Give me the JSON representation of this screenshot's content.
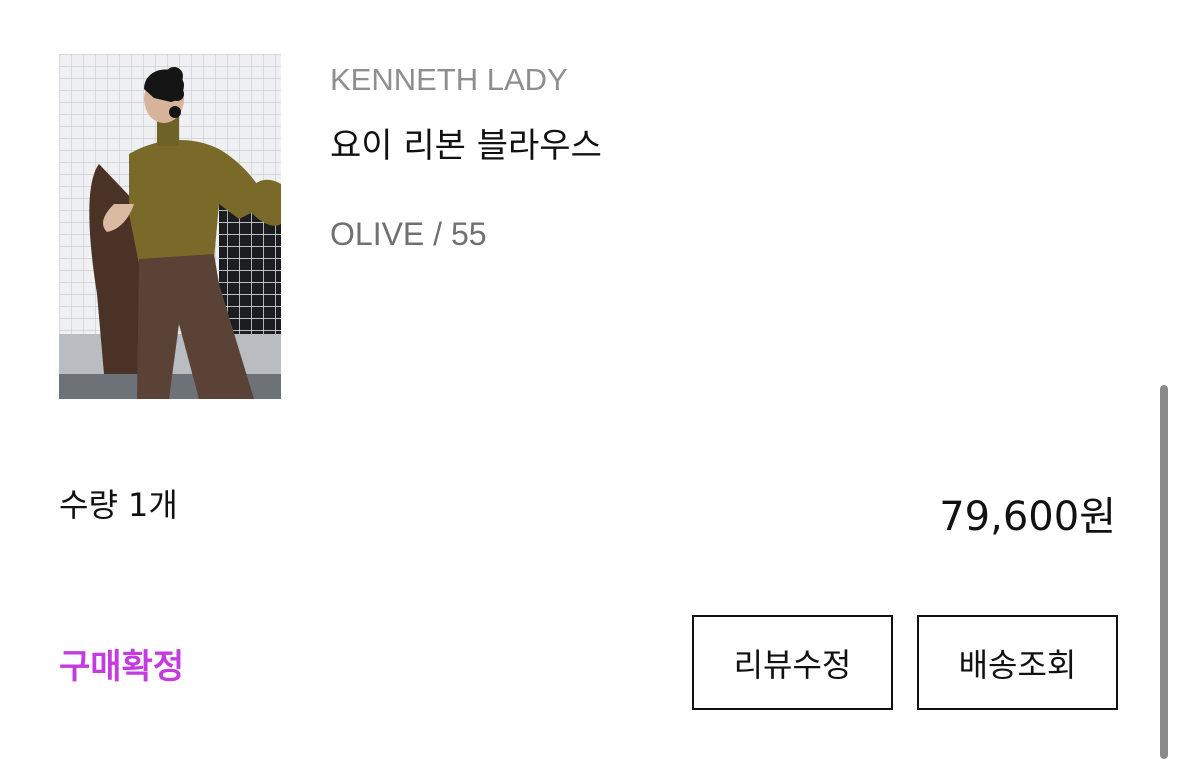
{
  "product": {
    "brand": "KENNETH LADY",
    "name": "요이 리본 블라우스",
    "option": "OLIVE / 55",
    "image_alt": "product-photo"
  },
  "order": {
    "quantity_label": "수량 1개",
    "price": "79,600원",
    "status": "구매확정",
    "status_color": "#c43be0"
  },
  "actions": {
    "review_edit": "리뷰수정",
    "track_delivery": "배송조회"
  }
}
